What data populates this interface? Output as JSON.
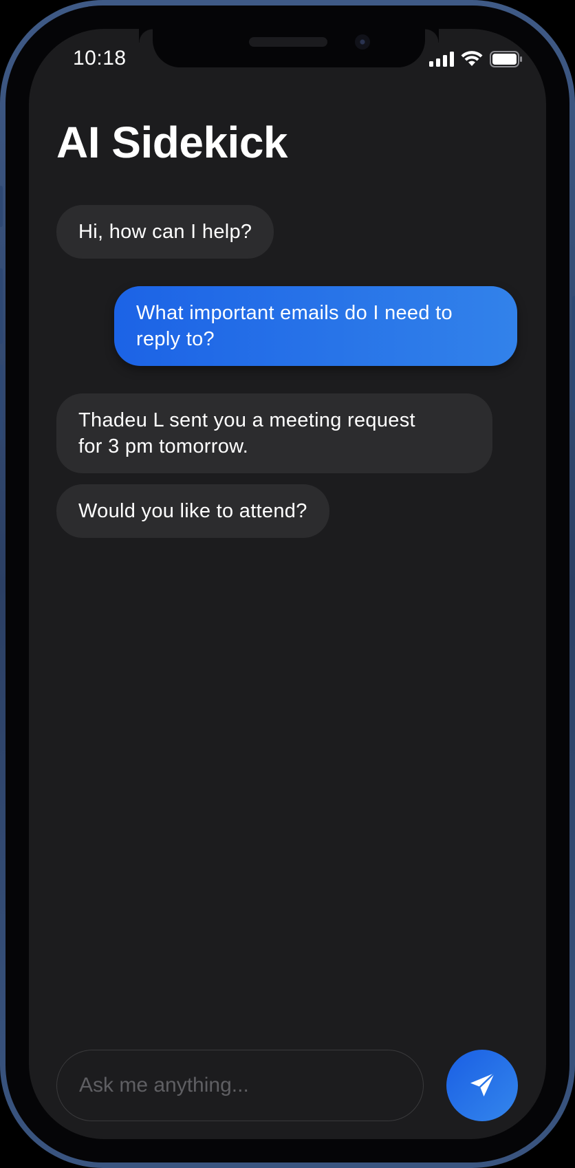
{
  "status_bar": {
    "time": "10:18",
    "icons": [
      "signal-icon",
      "wifi-icon",
      "battery-icon"
    ]
  },
  "app": {
    "title": "AI Sidekick"
  },
  "messages": [
    {
      "sender": "bot",
      "text": "Hi, how can I help?"
    },
    {
      "sender": "user",
      "text": "What important emails do I need to\nreply to?"
    },
    {
      "sender": "bot",
      "text": "Thadeu L sent you a meeting request\nfor 3 pm tomorrow."
    },
    {
      "sender": "bot",
      "text": "Would you like to attend?"
    }
  ],
  "composer": {
    "placeholder": "Ask me anything...",
    "send_icon": "send-icon"
  },
  "colors": {
    "screen_background": "#1c1c1e",
    "bot_bubble": "#2c2c2e",
    "user_bubble_accent": "#2270e8",
    "frame": "#3a5580"
  }
}
